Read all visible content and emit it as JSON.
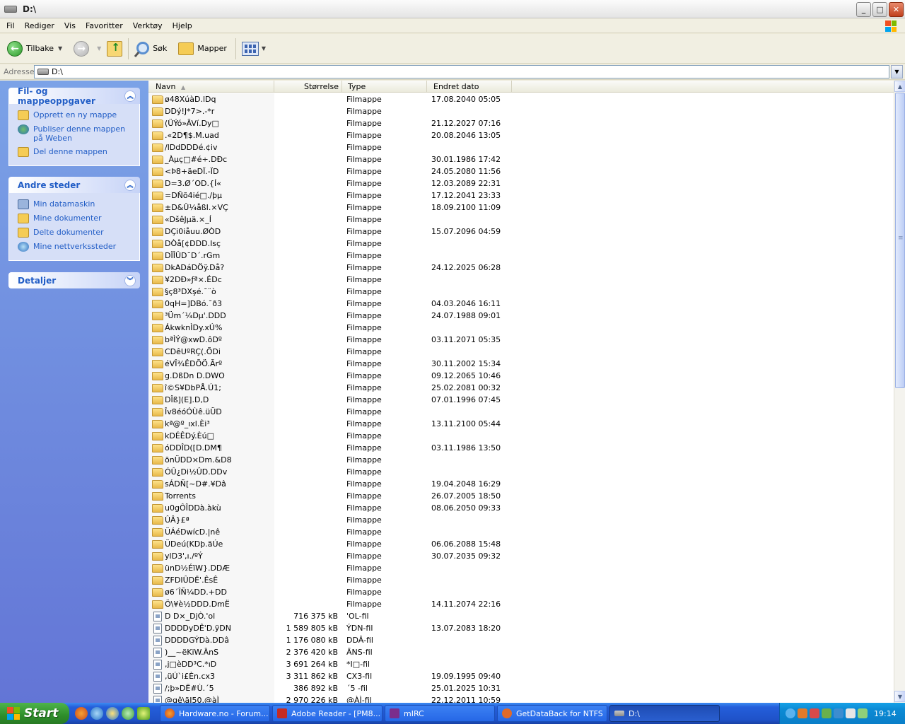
{
  "window": {
    "title": "D:\\",
    "buttons": [
      "_",
      "□",
      "✕"
    ]
  },
  "menu": [
    "Fil",
    "Rediger",
    "Vis",
    "Favoritter",
    "Verktøy",
    "Hjelp"
  ],
  "toolbar": {
    "back_label": "Tilbake",
    "search_label": "Søk",
    "folders_label": "Mapper"
  },
  "address": {
    "label": "Adresse",
    "value": "D:\\"
  },
  "left_pane": {
    "file_tasks": {
      "title": "Fil- og mappeoppgaver",
      "items": [
        "Opprett en ny mappe",
        "Publiser denne mappen på Weben",
        "Del denne mappen"
      ]
    },
    "other_places": {
      "title": "Andre steder",
      "items": [
        "Min datamaskin",
        "Mine dokumenter",
        "Delte dokumenter",
        "Mine nettverkssteder"
      ]
    },
    "details": {
      "title": "Detaljer"
    }
  },
  "columns": {
    "name": "Navn",
    "size": "Størrelse",
    "type": "Type",
    "date": "Endret dato"
  },
  "files": [
    {
      "name": "ø48XúàD.lDq",
      "size": "",
      "type": "Filmappe",
      "date": "17.08.2040 05:05",
      "kind": "folder"
    },
    {
      "name": "DDý!J*7>.-*r",
      "size": "",
      "type": "Filmappe",
      "date": "",
      "kind": "folder"
    },
    {
      "name": "(ÜÝó»ÃVí.Dy□",
      "size": "",
      "type": "Filmappe",
      "date": "21.12.2027 07:16",
      "kind": "folder"
    },
    {
      "name": ".«2D¶$.M.uad",
      "size": "",
      "type": "Filmappe",
      "date": "20.08.2046 13:05",
      "kind": "folder"
    },
    {
      "name": "/lDdDDDé.¢iv",
      "size": "",
      "type": "Filmappe",
      "date": "",
      "kind": "folder"
    },
    {
      "name": "_Àµç□#é÷.DÐc",
      "size": "",
      "type": "Filmappe",
      "date": "30.01.1986 17:42",
      "kind": "folder"
    },
    {
      "name": "<Þ8+ãeDÏ.-ÏD",
      "size": "",
      "type": "Filmappe",
      "date": "24.05.2080 11:56",
      "kind": "folder"
    },
    {
      "name": "D=3.Ø´OD.{Í«",
      "size": "",
      "type": "Filmappe",
      "date": "12.03.2089 22:31",
      "kind": "folder"
    },
    {
      "name": "=DÑõ4ié□./þµ",
      "size": "",
      "type": "Filmappe",
      "date": "17.12.2041 23:33",
      "kind": "folder"
    },
    {
      "name": "±D&Û¼åßI.×VÇ",
      "size": "",
      "type": "Filmappe",
      "date": "18.09.2100 11:09",
      "kind": "folder"
    },
    {
      "name": "«DšêJµä.×_Í",
      "size": "",
      "type": "Filmappe",
      "date": "",
      "kind": "folder"
    },
    {
      "name": "DÇi0iåuu.ØÒD",
      "size": "",
      "type": "Filmappe",
      "date": "15.07.2096 04:59",
      "kind": "folder"
    },
    {
      "name": "DÒå[¢DDD.Isç",
      "size": "",
      "type": "Filmappe",
      "date": "",
      "kind": "folder"
    },
    {
      "name": "DÎÎÛD¯D´.rGm",
      "size": "",
      "type": "Filmappe",
      "date": "",
      "kind": "folder"
    },
    {
      "name": "DkADáDÖÿ.Då?",
      "size": "",
      "type": "Filmappe",
      "date": "24.12.2025 06:28",
      "kind": "folder"
    },
    {
      "name": "¥2DÐ»ƒª×.ÉDc",
      "size": "",
      "type": "Filmappe",
      "date": "",
      "kind": "folder"
    },
    {
      "name": "§ç8³DXşé.¯¨ò",
      "size": "",
      "type": "Filmappe",
      "date": "",
      "kind": "folder"
    },
    {
      "name": "0qH=]DBó.¯ð3",
      "size": "",
      "type": "Filmappe",
      "date": "04.03.2046 16:11",
      "kind": "folder"
    },
    {
      "name": "³Üm´¼Dµ'.DDD",
      "size": "",
      "type": "Filmappe",
      "date": "24.07.1988 09:01",
      "kind": "folder"
    },
    {
      "name": "ÁkwknÌDy.xÚ%",
      "size": "",
      "type": "Filmappe",
      "date": "",
      "kind": "folder"
    },
    {
      "name": "bªÌÝ@xwD.ôDº",
      "size": "",
      "type": "Filmappe",
      "date": "03.11.2071 05:35",
      "kind": "folder"
    },
    {
      "name": "CDêUºRÇ(.ÕDi",
      "size": "",
      "type": "Filmappe",
      "date": "",
      "kind": "folder"
    },
    {
      "name": "éVÎ¾ÊDÕÖ.Ãrº",
      "size": "",
      "type": "Filmappe",
      "date": "30.11.2002 15:34",
      "kind": "folder"
    },
    {
      "name": "g.DßDn D.DWO",
      "size": "",
      "type": "Filmappe",
      "date": "09.12.2065 10:46",
      "kind": "folder"
    },
    {
      "name": "î©S¥DbPÅ.Ú1;",
      "size": "",
      "type": "Filmappe",
      "date": "25.02.2081 00:32",
      "kind": "folder"
    },
    {
      "name": "DÎß](E].D,D",
      "size": "",
      "type": "Filmappe",
      "date": "07.01.1996 07:45",
      "kind": "folder"
    },
    {
      "name": "Îv8éóÓÙê.üÜD",
      "size": "",
      "type": "Filmappe",
      "date": "",
      "kind": "folder"
    },
    {
      "name": "kª@º_ıxl.Èi³",
      "size": "",
      "type": "Filmappe",
      "date": "13.11.2100 05:44",
      "kind": "folder"
    },
    {
      "name": "kDÉÊDý.Èú□",
      "size": "",
      "type": "Filmappe",
      "date": "",
      "kind": "folder"
    },
    {
      "name": "óDDÎD([D.DM¶",
      "size": "",
      "type": "Filmappe",
      "date": "03.11.1986 13:50",
      "kind": "folder"
    },
    {
      "name": "õnÜDD×Dm.&D8",
      "size": "",
      "type": "Filmappe",
      "date": "",
      "kind": "folder"
    },
    {
      "name": "ÓÛ¿Di½ÛD.DDv",
      "size": "",
      "type": "Filmappe",
      "date": "",
      "kind": "folder"
    },
    {
      "name": "sÁDÑ[~D#.¥Dâ",
      "size": "",
      "type": "Filmappe",
      "date": "19.04.2048 16:29",
      "kind": "folder"
    },
    {
      "name": "Torrents",
      "size": "",
      "type": "Filmappe",
      "date": "26.07.2005 18:50",
      "kind": "folder"
    },
    {
      "name": "u0gÔÎDDà.àkù",
      "size": "",
      "type": "Filmappe",
      "date": "08.06.2050 09:33",
      "kind": "folder"
    },
    {
      "name": "ÛÂ}£ª",
      "size": "",
      "type": "Filmappe",
      "date": "",
      "kind": "folder"
    },
    {
      "name": "ÜÁéDwícD.|nê",
      "size": "",
      "type": "Filmappe",
      "date": "",
      "kind": "folder"
    },
    {
      "name": "ÜDeú(KDþ.äÚe",
      "size": "",
      "type": "Filmappe",
      "date": "06.06.2088 15:48",
      "kind": "folder"
    },
    {
      "name": "ylD3',ı./ºÝ",
      "size": "",
      "type": "Filmappe",
      "date": "30.07.2035 09:32",
      "kind": "folder"
    },
    {
      "name": "ünD½ÉïW}.DDÆ",
      "size": "",
      "type": "Filmappe",
      "date": "",
      "kind": "folder"
    },
    {
      "name": "ZFDIÛDË'.ÊsÊ",
      "size": "",
      "type": "Filmappe",
      "date": "",
      "kind": "folder"
    },
    {
      "name": "ø6´ÎÑ¼DD.+DD",
      "size": "",
      "type": "Filmappe",
      "date": "",
      "kind": "folder"
    },
    {
      "name": "Ö\\¥è½DDD.DmË",
      "size": "",
      "type": "Filmappe",
      "date": "14.11.2074 22:16",
      "kind": "folder"
    },
    {
      "name": "D D×_DjÒ.'ol",
      "size": "716 375 kB",
      "type": "'OL-fil",
      "date": "",
      "kind": "file"
    },
    {
      "name": "DDDDyDÊ'D.ÿDN",
      "size": "1 589 805 kB",
      "type": "ÝDN-fil",
      "date": "13.07.2083 18:20",
      "kind": "file"
    },
    {
      "name": "DDDDGÝDà.DDâ",
      "size": "1 176 080 kB",
      "type": "DDÂ-fil",
      "date": "",
      "kind": "file"
    },
    {
      "name": ")__~ëKiW.ÄnS",
      "size": "2 376 420 kB",
      "type": "ÄNS-fil",
      "date": "",
      "kind": "file"
    },
    {
      "name": ",j□èDD³C.*ıD",
      "size": "3 691 264 kB",
      "type": "*I□-fil",
      "date": "",
      "kind": "file"
    },
    {
      "name": ",üÚ`i£Èn.cx3",
      "size": "3 311 862 kB",
      "type": "CX3-fil",
      "date": "19.09.1995 09:40",
      "kind": "file"
    },
    {
      "name": "/;þ»DË#Ù.´5",
      "size": "386 892 kB",
      "type": "´5 -fil",
      "date": "25.01.2025 10:31",
      "kind": "file"
    },
    {
      "name": "@gê\\ãI50.@àÌ",
      "size": "2 970 226 kB",
      "type": "@ÀÌ-fil",
      "date": "22.12.2011 10:59",
      "kind": "file"
    }
  ],
  "taskbar": {
    "start_label": "Start",
    "tasks": [
      "Hardware.no - Forum...",
      "Adobe Reader - [PM8...",
      "mIRC",
      "GetDataBack for NTFS",
      "D:\\"
    ],
    "clock": "19:14"
  }
}
